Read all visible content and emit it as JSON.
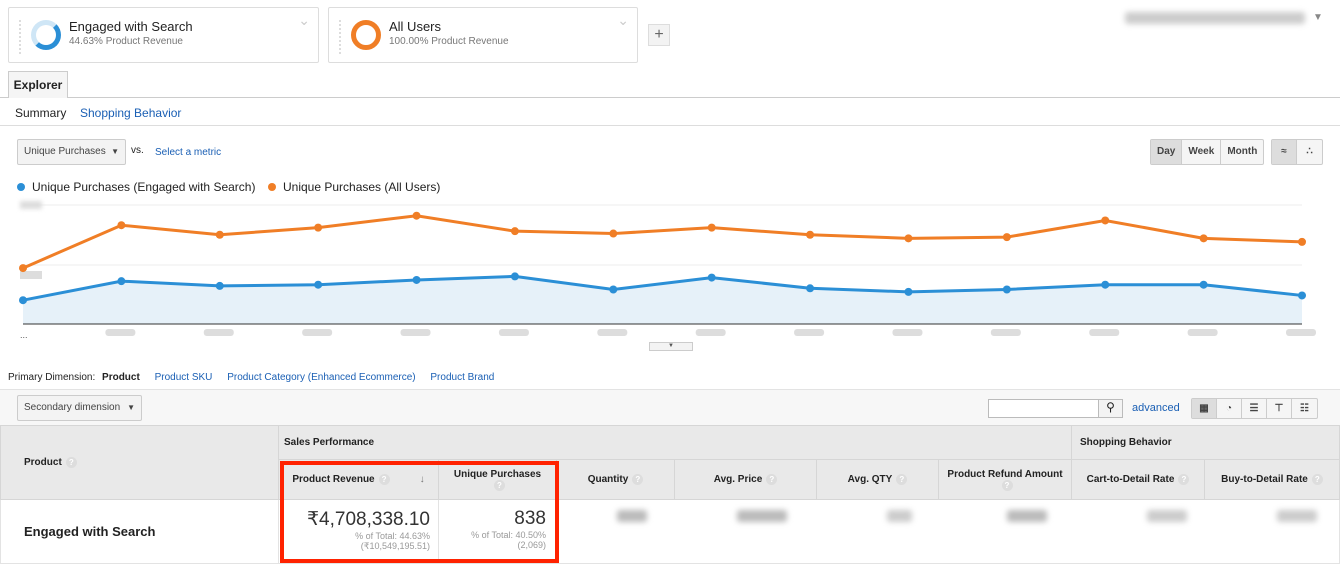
{
  "segments": [
    {
      "name": "Engaged with Search",
      "subtitle": "44.63% Product Revenue",
      "color": "#2b8fd6"
    },
    {
      "name": "All Users",
      "subtitle": "100.00% Product Revenue",
      "color": "#f07e26"
    }
  ],
  "add_segment": "+",
  "tab": "Explorer",
  "subtabs": {
    "summary": "Summary",
    "shopping": "Shopping Behavior"
  },
  "metric": {
    "selected": "Unique Purchases",
    "vs": "vs.",
    "select_metric": "Select a metric"
  },
  "period": {
    "day": "Day",
    "week": "Week",
    "month": "Month"
  },
  "legend": [
    "Unique Purchases (Engaged with Search)",
    "Unique Purchases (All Users)"
  ],
  "chart_data": {
    "type": "line",
    "title": "",
    "xlabel": "",
    "ylabel": "",
    "ylim": [
      0,
      100
    ],
    "x": [
      1,
      2,
      3,
      4,
      5,
      6,
      7,
      8,
      9,
      10,
      11,
      12,
      13,
      14
    ],
    "series": [
      {
        "name": "Unique Purchases (Engaged with Search)",
        "color": "#2b8fd6",
        "values": [
          20,
          36,
          32,
          33,
          37,
          40,
          29,
          39,
          30,
          27,
          29,
          33,
          33,
          24
        ]
      },
      {
        "name": "Unique Purchases (All Users)",
        "color": "#f07e26",
        "values": [
          47,
          83,
          75,
          81,
          91,
          78,
          76,
          81,
          75,
          72,
          73,
          87,
          72,
          69
        ]
      }
    ]
  },
  "axis_ellipsis": "...",
  "dimension": {
    "label": "Primary Dimension:",
    "active": "Product",
    "options": [
      "Product SKU",
      "Product Category (Enhanced Ecommerce)",
      "Product Brand"
    ]
  },
  "secondary": "Secondary dimension",
  "advanced": "advanced",
  "table": {
    "product_header": "Product",
    "groups": [
      "Sales Performance",
      "Shopping Behavior"
    ],
    "columns": [
      "Product Revenue",
      "Unique Purchases",
      "Quantity",
      "Avg. Price",
      "Avg. QTY",
      "Product Refund Amount",
      "Cart-to-Detail Rate",
      "Buy-to-Detail Rate"
    ],
    "row": {
      "name": "Engaged with Search",
      "revenue": "₹4,708,338.10",
      "revenue_pct": "% of Total: 44.63%",
      "revenue_total": "(₹10,549,195.51)",
      "purchases": "838",
      "purchases_pct": "% of Total: 40.50%",
      "purchases_total": "(2,069)"
    }
  }
}
